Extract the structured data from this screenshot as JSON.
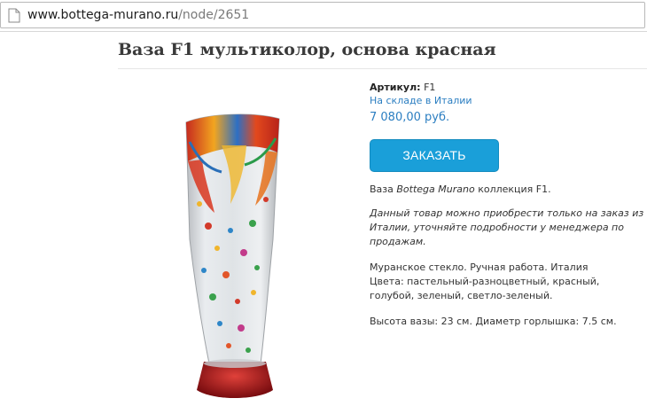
{
  "browser": {
    "url_host": "www.bottega-murano.ru",
    "url_path": "/node/2651"
  },
  "page": {
    "title": "Ваза F1 мультиколор, основа красная"
  },
  "product": {
    "sku_label": "Артикул:",
    "sku_value": "F1",
    "stock": "На складе в Италии",
    "price": "7 080,00 руб.",
    "order_button": "ЗАКАЗАТЬ",
    "desc_line1_prefix": "Ваза ",
    "desc_line1_brand": "Bottega Murano",
    "desc_line1_suffix": " коллекция F1.",
    "desc_note": "Данный товар можно приобрести только на заказ из Италии, уточняйте подробности у менеджера по продажам.",
    "desc_material": "Муранское стекло. Ручная работа. Италия",
    "desc_colors": "Цвета: пастельный-разноцветный, красный, голубой, зеленый, светло-зеленый.",
    "desc_size": "Высота вазы: 23 см. Диаметр горлышка: 7.5 см."
  }
}
